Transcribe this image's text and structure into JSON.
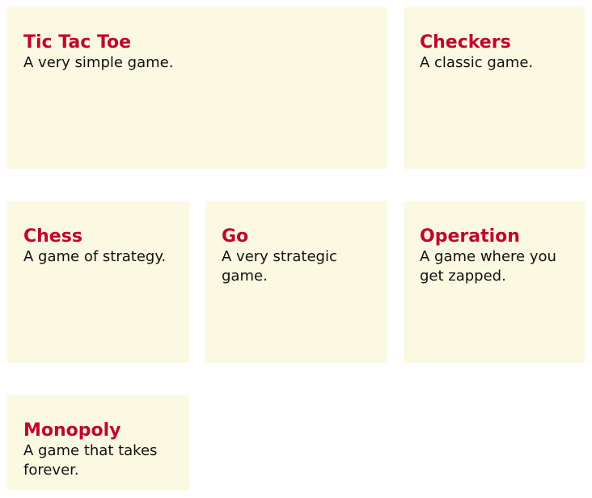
{
  "games": [
    {
      "title": "Tic Tac Toe",
      "description": "A very simple game."
    },
    {
      "title": "Checkers",
      "description": "A classic game."
    },
    {
      "title": "Chess",
      "description": "A game of strategy."
    },
    {
      "title": "Go",
      "description": "A very strategic game."
    },
    {
      "title": "Operation",
      "description": "A game where you get zapped."
    },
    {
      "title": "Monopoly",
      "description": "A game that takes forever."
    }
  ]
}
